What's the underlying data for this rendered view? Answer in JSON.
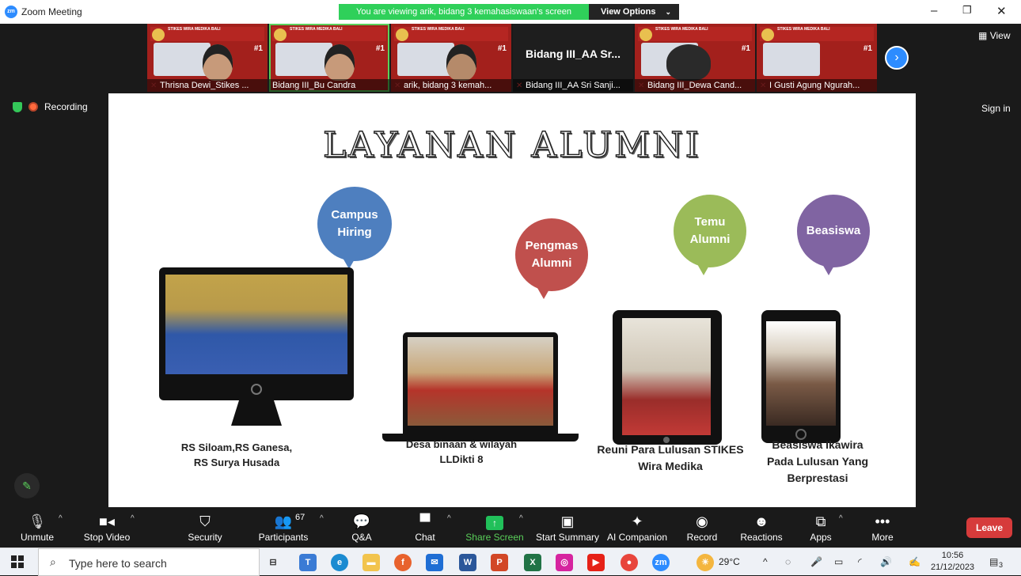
{
  "window": {
    "title": "Zoom Meeting",
    "zoom_logo_text": "zm",
    "viewing_banner": "You are viewing arik, bidang 3 kemahasiswaan's screen",
    "view_options_label": "View Options",
    "controls": [
      "–",
      "❐",
      "✕"
    ]
  },
  "thumbnails": [
    {
      "name": "Thrisna Dewi_Stikes ...",
      "type": "poster-face",
      "active": false
    },
    {
      "name": "Bidang III_Bu Candra",
      "type": "poster-face",
      "active": true
    },
    {
      "name": "arik, bidang 3 kemah...",
      "type": "poster-face",
      "active": false
    },
    {
      "name": "Bidang III_AA Sri Sanji...",
      "type": "dark",
      "active": false,
      "display_name": "Bidang III_AA Sr..."
    },
    {
      "name": "Bidang III_Dewa Cand...",
      "type": "poster-face",
      "active": false
    },
    {
      "name": "I Gusti Agung Ngurah...",
      "type": "poster",
      "active": false
    }
  ],
  "poster_header_text": "STIKES WIRA MEDIKA BALI",
  "poster_rank_text": "#1",
  "view_label": "View",
  "recording_label": "Recording",
  "signin_label": "Sign in",
  "slide": {
    "title": "LAYANAN ALUMNI",
    "bubbles": [
      {
        "label": "Campus Hiring",
        "color": "#4e7fbf"
      },
      {
        "label": "Pengmas Alumni",
        "color": "#c0504d"
      },
      {
        "label": "Temu Alumni",
        "color": "#9bbb59"
      },
      {
        "label": "Beasiswa",
        "color": "#8064a2"
      }
    ],
    "captions": [
      "RS Siloam,RS Ganesa, RS Surya Husada",
      "Desa binaan & wilayah LLDikti 8",
      "Reuni Para Lulusan STIKES Wira Medika",
      "Beasiswa Ikawira Pada Lulusan Yang Berprestasi"
    ]
  },
  "toolbar": {
    "unmute": "Unmute",
    "stop_video": "Stop Video",
    "security": "Security",
    "participants": "Participants",
    "participants_count": "67",
    "qa": "Q&A",
    "chat": "Chat",
    "share_screen": "Share Screen",
    "start_summary": "Start Summary",
    "ai_companion": "AI Companion",
    "record": "Record",
    "reactions": "Reactions",
    "apps": "Apps",
    "more": "More",
    "leave": "Leave"
  },
  "taskbar": {
    "search_placeholder": "Type here to search",
    "temperature": "29°C",
    "time": "10:56",
    "date": "21/12/2023",
    "notification_count": "3"
  }
}
